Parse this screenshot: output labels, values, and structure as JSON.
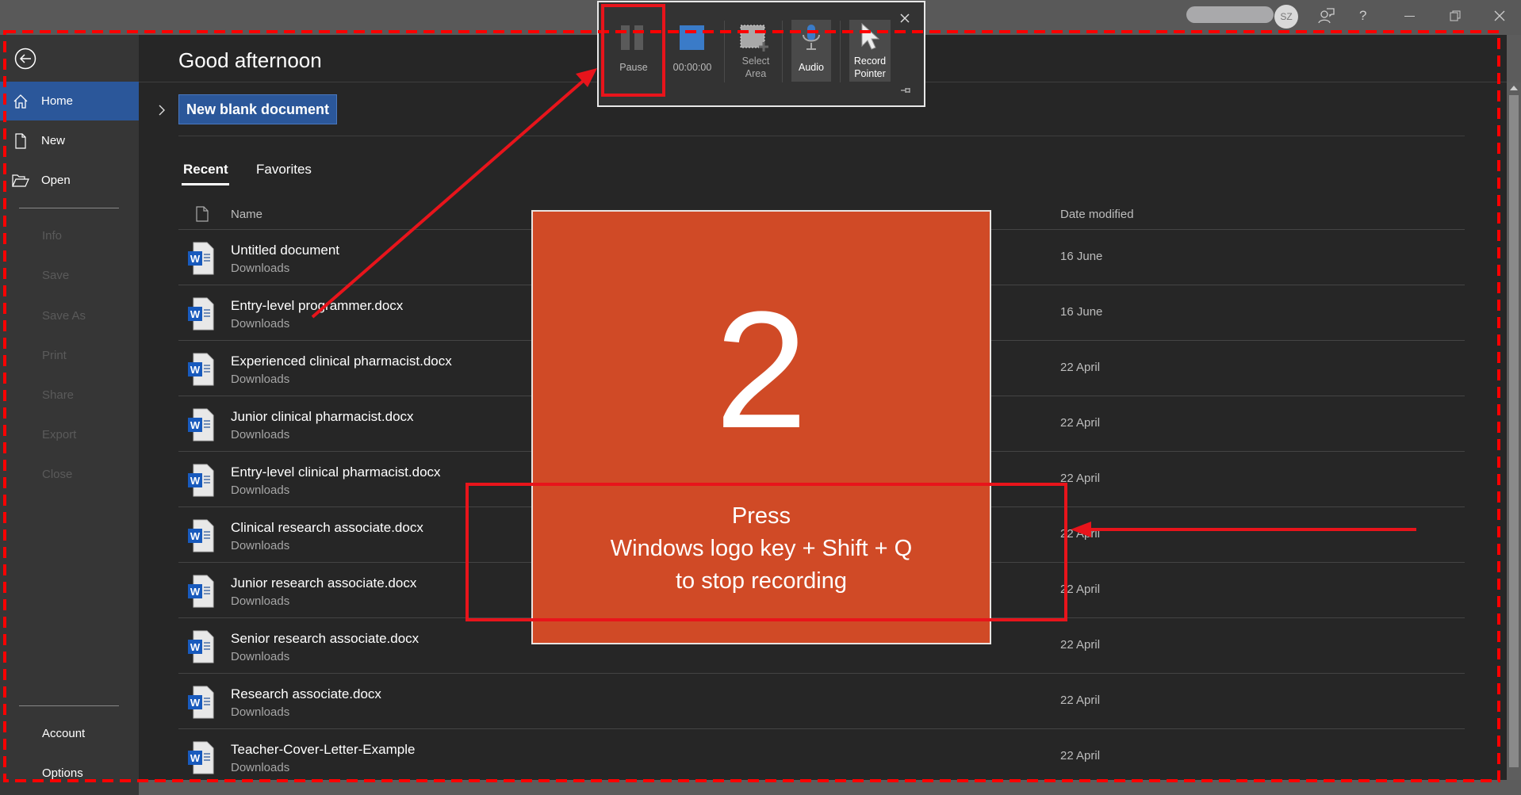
{
  "titlebar": {
    "avatar_initials": "SZ",
    "help": "?"
  },
  "sidebar": {
    "items": [
      {
        "label": "Home",
        "icon": "home-icon",
        "active": true
      },
      {
        "label": "New",
        "icon": "new-document-icon"
      },
      {
        "label": "Open",
        "icon": "folder-open-icon"
      }
    ],
    "disabled_items": [
      "Info",
      "Save",
      "Save As",
      "Print",
      "Share",
      "Export",
      "Close"
    ],
    "bottom_items": [
      "Account",
      "Options"
    ]
  },
  "main": {
    "greeting": "Good afternoon",
    "new_blank_label": "New blank document",
    "tabs": [
      {
        "label": "Recent",
        "active": true
      },
      {
        "label": "Favorites"
      }
    ],
    "columns": {
      "name": "Name",
      "date": "Date modified"
    },
    "files": [
      {
        "name": "Untitled document",
        "location": "Downloads",
        "date": "16 June"
      },
      {
        "name": "Entry-level programmer.docx",
        "location": "Downloads",
        "date": "16 June"
      },
      {
        "name": "Experienced clinical pharmacist.docx",
        "location": "Downloads",
        "date": "22 April"
      },
      {
        "name": "Junior clinical pharmacist.docx",
        "location": "Downloads",
        "date": "22 April"
      },
      {
        "name": "Entry-level clinical pharmacist.docx",
        "location": "Downloads",
        "date": "22 April"
      },
      {
        "name": "Clinical research associate.docx",
        "location": "Downloads",
        "date": "22 April"
      },
      {
        "name": "Junior research associate.docx",
        "location": "Downloads",
        "date": "22 April"
      },
      {
        "name": "Senior research associate.docx",
        "location": "Downloads",
        "date": "22 April"
      },
      {
        "name": "Research associate.docx",
        "location": "Downloads",
        "date": "22 April"
      },
      {
        "name": "Teacher-Cover-Letter-Example",
        "location": "Downloads",
        "date": "22 April"
      }
    ]
  },
  "recorder": {
    "pause": "Pause",
    "timer": "00:00:00",
    "select_area": "Select\nArea",
    "audio": "Audio",
    "record_pointer": "Record\nPointer"
  },
  "countdown": {
    "number": "2",
    "line1": "Press",
    "line2": "Windows logo key + Shift + Q",
    "line3": "to stop recording"
  },
  "colors": {
    "accent": "#2b579a",
    "overlay": "#d04a26",
    "annotation": "#e8141b",
    "stop": "#3a7bc8"
  }
}
